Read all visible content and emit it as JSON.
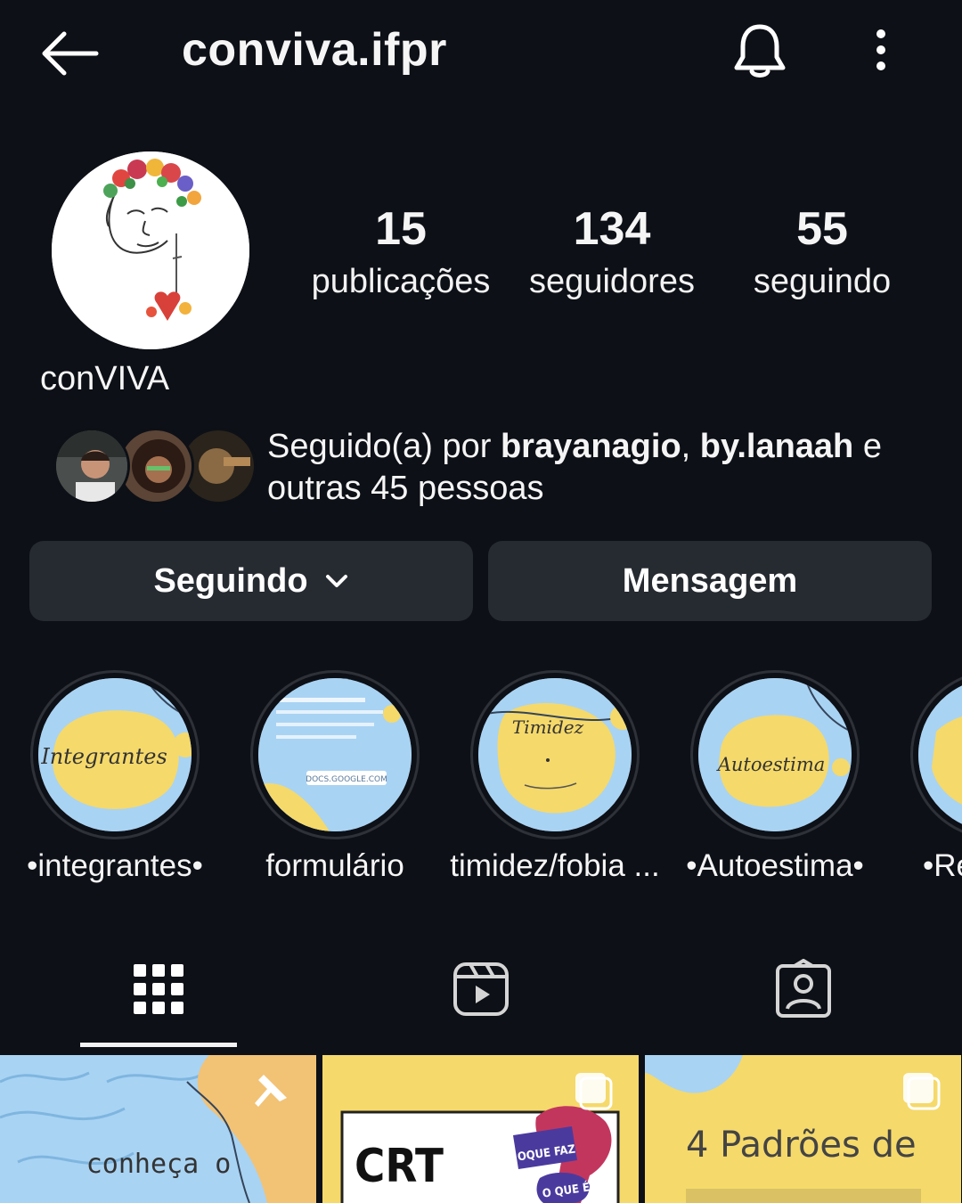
{
  "header": {
    "title": "conviva.ifpr",
    "back_icon": "arrow-left-icon",
    "bell_icon": "bell-icon",
    "more_icon": "more-vertical-icon"
  },
  "profile": {
    "display_name": "conVIVA",
    "stats": [
      {
        "value": "15",
        "label": "publicações"
      },
      {
        "value": "134",
        "label": "seguidores"
      },
      {
        "value": "55",
        "label": "seguindo"
      }
    ]
  },
  "followed_by": {
    "prefix": "Seguido(a) por ",
    "user1": "brayanagio",
    "sep": ", ",
    "user2": "by.lanaah",
    "suffix": " e",
    "line2": "outras 45 pessoas"
  },
  "actions": {
    "following_label": "Seguindo",
    "message_label": "Mensagem"
  },
  "highlights": [
    {
      "label": "•integrantes•",
      "cover_text": "Integrantes"
    },
    {
      "label": "formulário",
      "cover_text": "DOCS.GOOGLE.COM"
    },
    {
      "label": "timidez/fobia ...",
      "cover_text": "Timidez"
    },
    {
      "label": "•Autoestima•",
      "cover_text": "Autoestima"
    },
    {
      "label": "•Re"
    }
  ],
  "posts": [
    {
      "text": "conheça o"
    },
    {
      "text": "CRT",
      "badge1": "OQUE FAZ",
      "badge2": "O QUE É"
    },
    {
      "text": "4 Padrões de"
    }
  ],
  "colors": {
    "background": "#0d1016",
    "button": "#262a31",
    "highlight_blue": "#a9d3f3",
    "highlight_yellow": "#f5d96a"
  }
}
